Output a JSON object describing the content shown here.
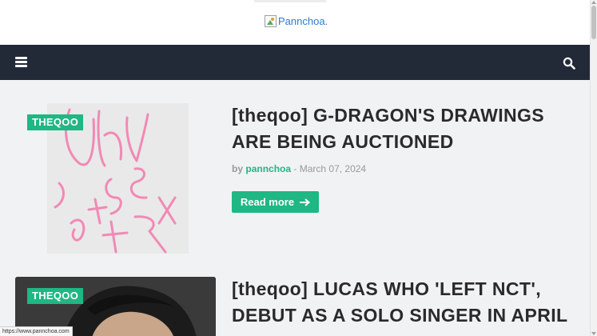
{
  "header": {
    "logo_alt": "Pannchoa."
  },
  "nav": {
    "menu_icon": "bars-icon",
    "search_icon": "search-icon"
  },
  "posts": [
    {
      "tag": "THEQOO",
      "title": "[theqoo] G-DRAGON'S DRAWINGS ARE BEING AUCTIONED",
      "by": "by",
      "author": "pannchoa",
      "separator": "-",
      "date": "March 07, 2024",
      "read_more": "Read more",
      "read_more_icon": "arrow-right-icon"
    },
    {
      "tag": "THEQOO",
      "title": "[theqoo] LUCAS WHO 'LEFT NCT', DEBUT AS A SOLO SINGER IN APRIL"
    }
  ],
  "status_bar": {
    "url": "https://www.pannchoa.com"
  },
  "colors": {
    "accent": "#1fb784",
    "navbar": "#222a38",
    "background": "#f1f2f3"
  }
}
